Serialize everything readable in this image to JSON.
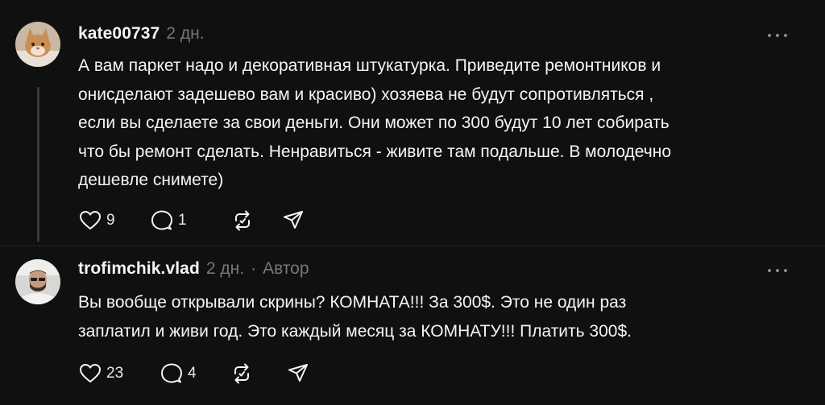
{
  "comments": [
    {
      "username": "kate00737",
      "time": "2 дн.",
      "role": "",
      "lines": [
        "А вам паркет надо и декоративная штукатурка. Приведите ремонтников и",
        "онисделают задешево вам и красиво) хозяева не будут сопротивляться ,",
        "если вы сделаете за свои деньги. Они может по 300 будут 10 лет собирать",
        "что бы ремонт сделать. Ненравиться - живите там подальше. В молодечно",
        "дешевле снимете)"
      ],
      "likes": "9",
      "replies": "1",
      "icons": [
        "heart-icon",
        "comment-icon",
        "repost-icon",
        "share-icon",
        "more-icon"
      ]
    },
    {
      "username": "trofimchik.vlad",
      "time": "2 дн.",
      "separator": "·",
      "role": "Автор",
      "lines": [
        "Вы вообще открывали скрины? КОМНАТА!!! За 300$. Это не один раз",
        "заплатил и живи год. Это каждый месяц за КОМНАТУ!!! Платить 300$."
      ],
      "likes": "23",
      "replies": "4",
      "icons": [
        "heart-icon",
        "comment-icon",
        "repost-icon",
        "share-icon",
        "more-icon"
      ]
    }
  ],
  "colors": {
    "background": "#101010",
    "text": "#f3f5f7",
    "muted": "#777777",
    "divider": "#262626"
  }
}
